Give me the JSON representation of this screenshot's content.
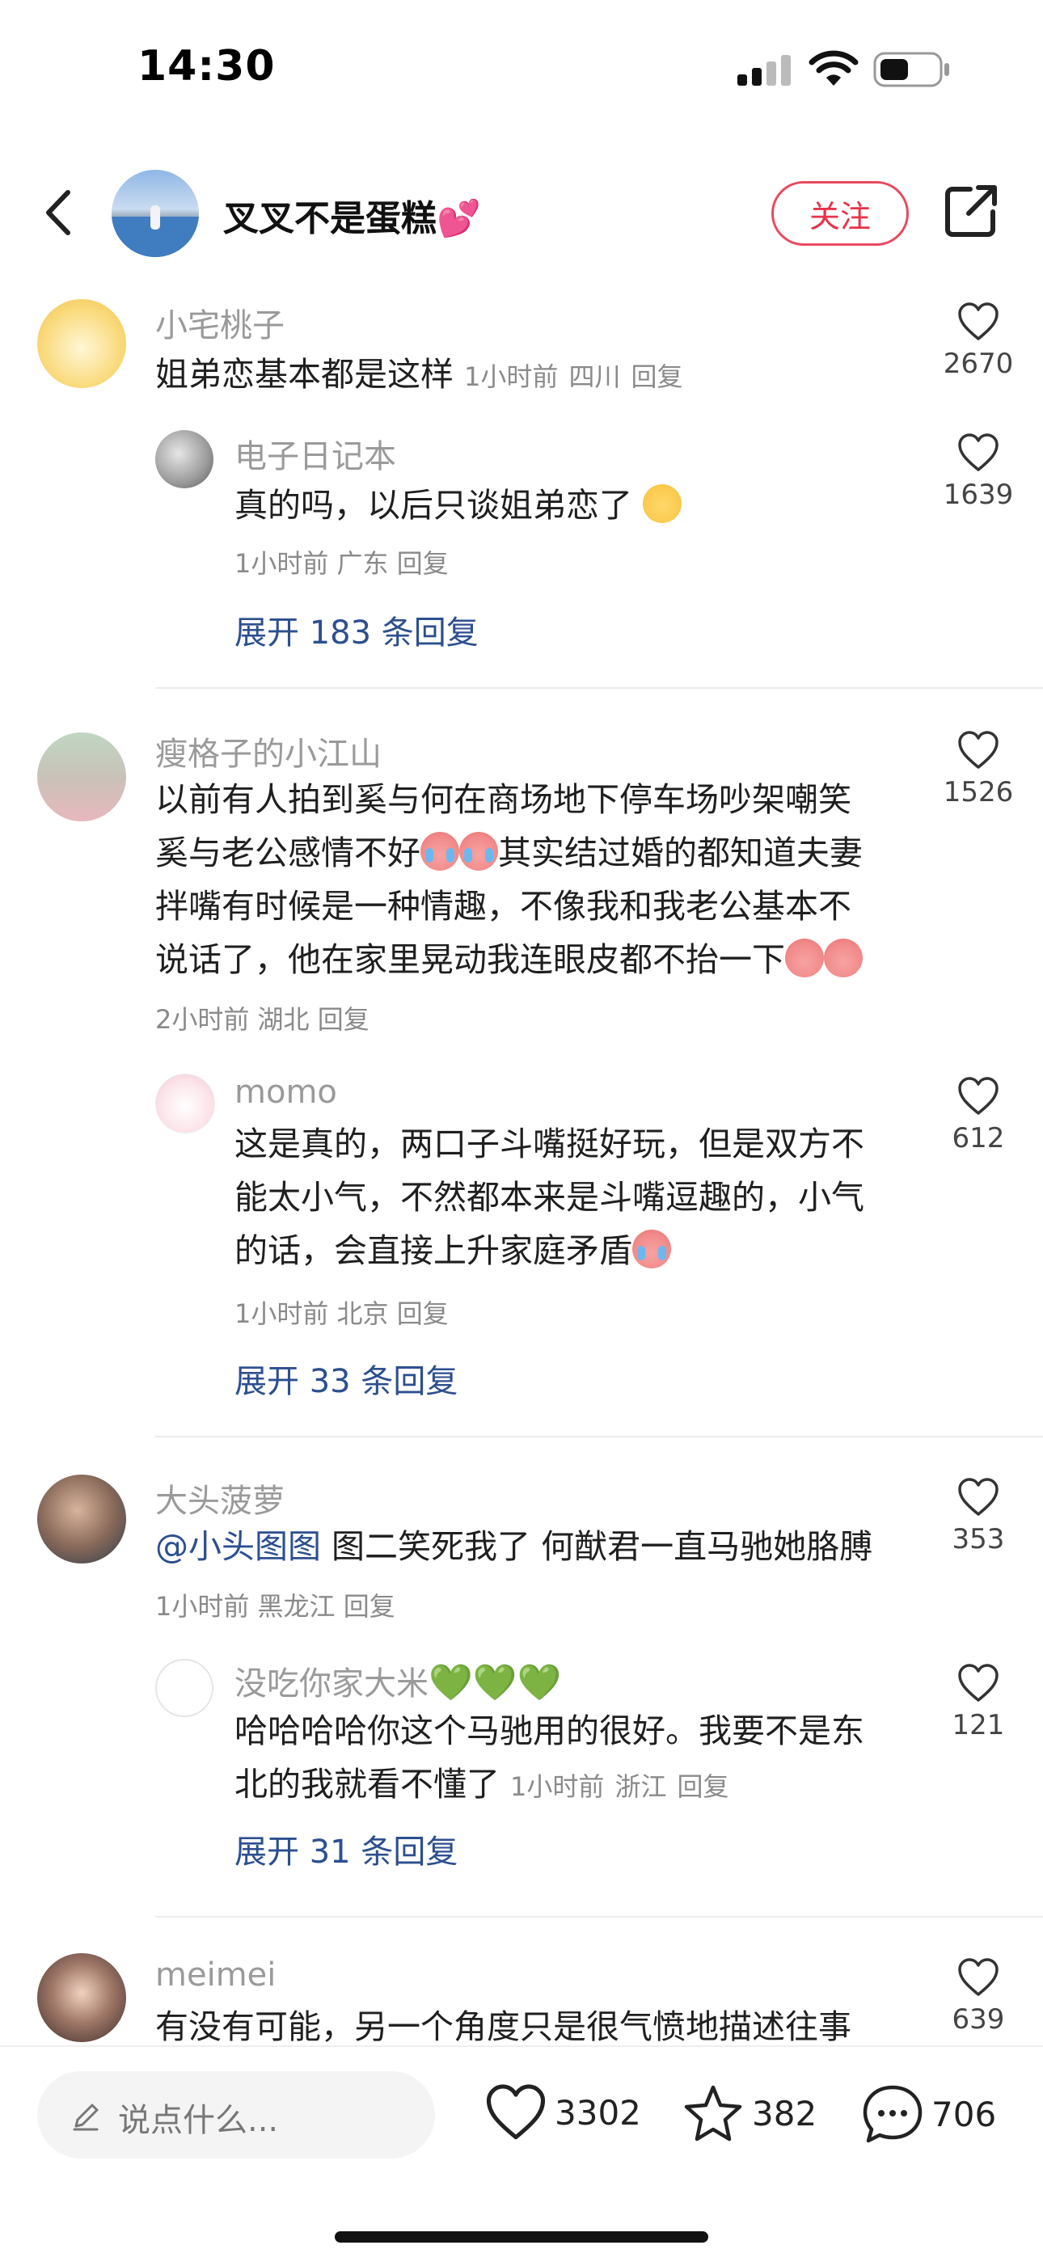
{
  "status": {
    "time": "14:30"
  },
  "header": {
    "title": "叉叉不是蛋糕💕",
    "follow_label": "关注"
  },
  "comments": [
    {
      "user": "小宅桃子",
      "text": "姐弟恋基本都是这样",
      "time": "1小时前",
      "location": "四川",
      "reply_label": "回复",
      "likes": "2670",
      "replies": [
        {
          "user": "电子日记本",
          "text": "真的吗，以后只谈姐弟恋了",
          "time": "1小时前",
          "location": "广东",
          "reply_label": "回复",
          "likes": "1639"
        }
      ],
      "expand": "展开 183 条回复"
    },
    {
      "user": "瘦格子的小江山",
      "lines": [
        "以前有人拍到奚与何在商场地下停车场吵架嘲笑",
        "奚与老公感情不好",
        "其实结过婚的都知道夫妻",
        "拌嘴有时候是一种情趣，不像我和我老公基本不",
        "说话了，他在家里晃动我连眼皮都不抬一下"
      ],
      "time": "2小时前",
      "location": "湖北",
      "reply_label": "回复",
      "likes": "1526",
      "replies": [
        {
          "user": "momo",
          "lines": [
            "这是真的，两口子斗嘴挺好玩，但是双方不",
            "能太小气，不然都本来是斗嘴逗趣的，小气",
            "的话，会直接上升家庭矛盾"
          ],
          "time": "1小时前",
          "location": "北京",
          "reply_label": "回复",
          "likes": "612"
        }
      ],
      "expand": "展开 33 条回复"
    },
    {
      "user": "大头菠萝",
      "mention": "@小头图图",
      "text": " 图二笑死我了 何猷君一直马驰她胳膊",
      "time": "1小时前",
      "location": "黑龙江",
      "reply_label": "回复",
      "likes": "353",
      "replies": [
        {
          "user": "没吃你家大米",
          "user_suffix": "💚💚💚",
          "lines": [
            "哈哈哈哈你这个马驰用的很好。我要不是东",
            "北的我就看不懂了"
          ],
          "time": "1小时前",
          "location": "浙江",
          "reply_label": "回复",
          "likes": "121"
        }
      ],
      "expand": "展开 31 条回复"
    },
    {
      "user": "meimei",
      "text": "有没有可能，另一个角度只是很气愤地描述往事",
      "likes": "639"
    }
  ],
  "bottom": {
    "input_placeholder": "说点什么...",
    "likes": "3302",
    "favorites": "382",
    "comments": "706"
  },
  "colors": {
    "accent_red": "#e8334a",
    "link_blue": "#2c4f8f"
  }
}
